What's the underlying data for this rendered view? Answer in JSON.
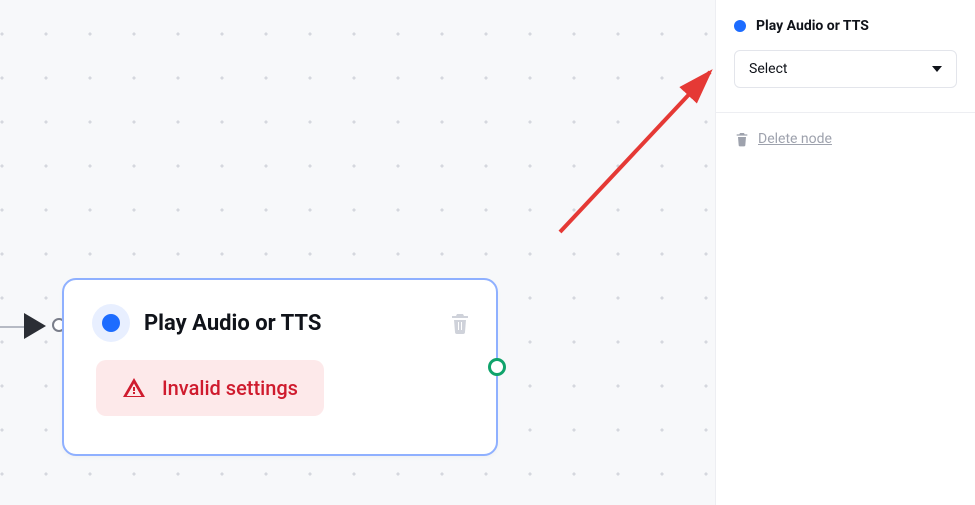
{
  "node": {
    "title": "Play Audio or TTS",
    "error_text": "Invalid settings"
  },
  "sidepanel": {
    "title": "Play Audio or TTS",
    "select_placeholder": "Select",
    "delete_label": "Delete node"
  }
}
